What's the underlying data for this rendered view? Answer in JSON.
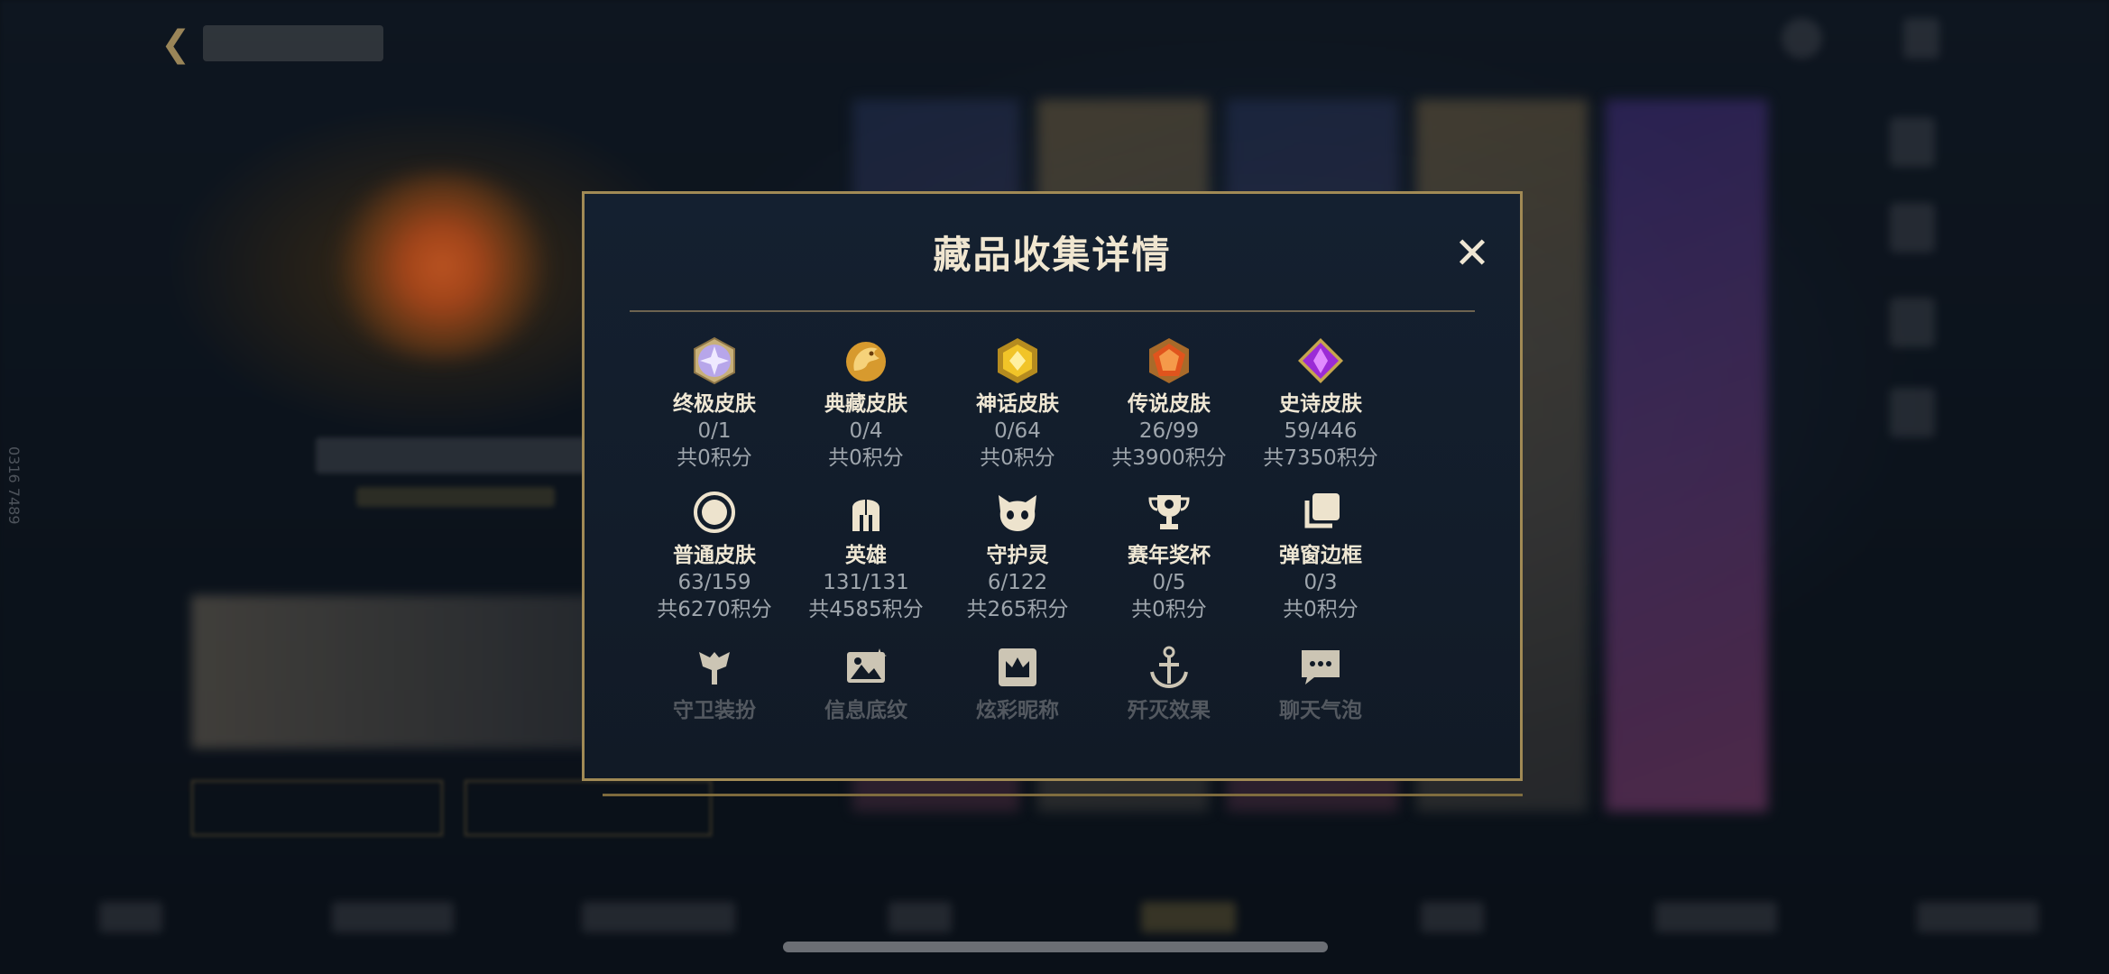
{
  "modal": {
    "title": "藏品收集详情",
    "close_symbol": "✕"
  },
  "collections": [
    {
      "icon": "ultimate-skin-gem-icon",
      "name": "终极皮肤",
      "count": "0/1",
      "points": "共0积分"
    },
    {
      "icon": "collector-skin-dragon-icon",
      "name": "典藏皮肤",
      "count": "0/4",
      "points": "共0积分"
    },
    {
      "icon": "mythic-skin-gem-icon",
      "name": "神话皮肤",
      "count": "0/64",
      "points": "共0积分"
    },
    {
      "icon": "legendary-skin-gem-icon",
      "name": "传说皮肤",
      "count": "26/99",
      "points": "共3900积分"
    },
    {
      "icon": "epic-skin-gem-icon",
      "name": "史诗皮肤",
      "count": "59/446",
      "points": "共7350积分"
    },
    {
      "icon": "normal-skin-circle-icon",
      "name": "普通皮肤",
      "count": "63/159",
      "points": "共6270积分"
    },
    {
      "icon": "hero-helmet-icon",
      "name": "英雄",
      "count": "131/131",
      "points": "共4585积分"
    },
    {
      "icon": "guardian-spirit-icon",
      "name": "守护灵",
      "count": "6/122",
      "points": "共265积分"
    },
    {
      "icon": "season-trophy-icon",
      "name": "赛年奖杯",
      "count": "0/5",
      "points": "共0积分"
    },
    {
      "icon": "popup-frame-icon",
      "name": "弹窗边框",
      "count": "0/3",
      "points": "共0积分"
    },
    {
      "icon": "guardian-outfit-icon",
      "name": "守卫装扮",
      "count": "",
      "points": ""
    },
    {
      "icon": "info-pattern-icon",
      "name": "信息底纹",
      "count": "",
      "points": ""
    },
    {
      "icon": "colorful-nickname-icon",
      "name": "炫彩昵称",
      "count": "",
      "points": ""
    },
    {
      "icon": "annihilation-effect-icon",
      "name": "歼灭效果",
      "count": "",
      "points": ""
    },
    {
      "icon": "chat-bubble-icon",
      "name": "聊天气泡",
      "count": "",
      "points": ""
    }
  ],
  "background": {
    "side_text": "0316 7489"
  },
  "colors": {
    "gold_border": "#a18a55",
    "modal_bg": "#142030",
    "title_text": "#f0e6d0",
    "muted_text": "#9fa6ad"
  }
}
